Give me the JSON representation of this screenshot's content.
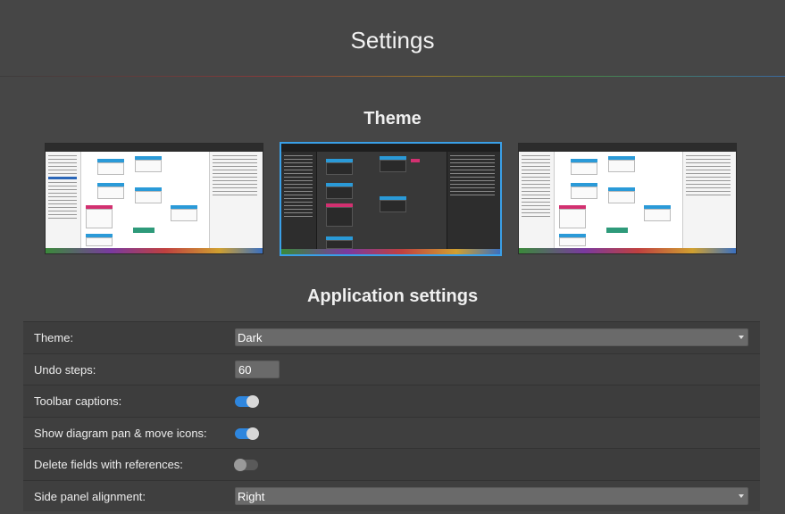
{
  "page": {
    "title": "Settings"
  },
  "theme_section": {
    "heading": "Theme",
    "options": [
      {
        "name": "Light",
        "selected": false
      },
      {
        "name": "Dark",
        "selected": true
      },
      {
        "name": "Light with dark toolbar",
        "selected": false
      }
    ]
  },
  "app_section": {
    "heading": "Application settings",
    "rows": [
      {
        "label": "Theme:",
        "control": "select",
        "value": "Dark"
      },
      {
        "label": "Undo steps:",
        "control": "number",
        "value": "60"
      },
      {
        "label": "Toolbar captions:",
        "control": "toggle",
        "on": true
      },
      {
        "label": "Show diagram pan & move icons:",
        "control": "toggle",
        "on": true
      },
      {
        "label": "Delete fields with references:",
        "control": "toggle",
        "on": false
      },
      {
        "label": "Side panel alignment:",
        "control": "select",
        "value": "Right"
      }
    ]
  },
  "colors": {
    "accent": "#2e86de",
    "selected_border": "#3aa0e8",
    "background": "#464646"
  }
}
